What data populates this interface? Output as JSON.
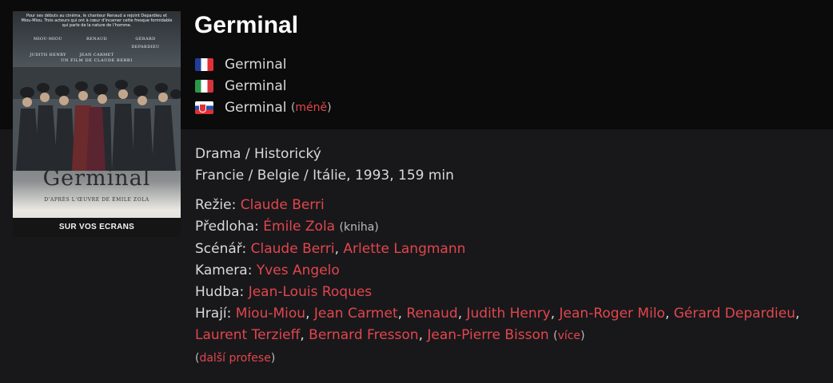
{
  "poster": {
    "blurb": "Pour ses débuts au cinéma, le chanteur Renaud a rejoint Depardieu et Miou-Miou. Trois acteurs qui ont à cœur d'incarner cette fresque formidable qui parle de la nature de l'homme.",
    "cast": [
      "MIOU-MIOU",
      "RENAUD",
      "GÉRARD DEPARDIEU",
      "JUDITH HENRY",
      "JEAN CARMET"
    ],
    "director": "UN FILM DE CLAUDE BERRI",
    "title": "Germinal",
    "credit": "D'APRÈS L'ŒUVRE DE ÉMILE ZOLA",
    "bottom_bar": "SUR VOS ECRANS"
  },
  "film": {
    "title": "Germinal"
  },
  "alt_titles": [
    {
      "flag": "flag-france-icon",
      "title": "Germinal"
    },
    {
      "flag": "flag-italy-icon",
      "title": "Germinal"
    },
    {
      "flag": "flag-slovakia-icon",
      "title": "Germinal",
      "toggle_open": "(",
      "toggle": "méně",
      "toggle_close": ")"
    }
  ],
  "genres": "Drama / Historický",
  "origin": "Francie / Belgie / Itálie, 1993, 159 min",
  "credits": {
    "directing": {
      "label": "Režie:",
      "names": [
        "Claude Berri"
      ]
    },
    "source": {
      "label": "Předloha:",
      "names": [
        "Émile Zola"
      ],
      "note": "(kniha)"
    },
    "screenplay": {
      "label": "Scénář:",
      "names": [
        "Claude Berri",
        "Arlette Langmann"
      ]
    },
    "camera": {
      "label": "Kamera:",
      "names": [
        "Yves Angelo"
      ]
    },
    "music": {
      "label": "Hudba:",
      "names": [
        "Jean-Louis Roques"
      ]
    },
    "cast": {
      "label": "Hrají:",
      "names": [
        "Miou-Miou",
        "Jean Carmet",
        "Renaud",
        "Judith Henry",
        "Jean-Roger Milo",
        "Gérard Depardieu",
        "Laurent Terzieff",
        "Bernard Fresson",
        "Jean-Pierre Bisson"
      ],
      "more": "více"
    }
  },
  "more_professions": "další profese",
  "separators": {
    "comma": ", ",
    "open": "(",
    "close": ")"
  },
  "colors": {
    "link": "#e2464c",
    "top_band": "#0b0b0b",
    "page_background": "#18181b"
  }
}
